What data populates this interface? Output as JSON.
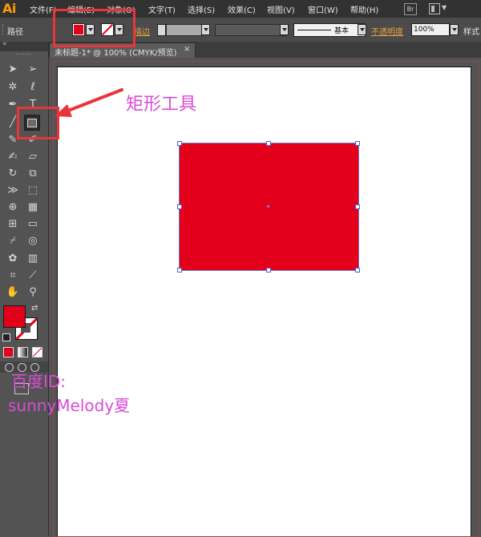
{
  "app": {
    "logo": "Ai"
  },
  "menu": {
    "items": [
      "文件(F)",
      "编辑(E)",
      "对象(O)",
      "文字(T)",
      "选择(S)",
      "效果(C)",
      "视图(V)",
      "窗口(W)",
      "帮助(H)"
    ]
  },
  "menu_right": {
    "bridge_label": "Br"
  },
  "control_bar": {
    "path_label": "路径",
    "fill_color": "#e2001a",
    "stroke": "none",
    "stroke_label": "描边",
    "stroke_profile": "基本",
    "opacity_label": "不透明度",
    "opacity_value": "100%",
    "style_label": "样式"
  },
  "document": {
    "tab_title": "未标题-1* @ 100% (CMYK/预览)",
    "close_symbol": "×"
  },
  "canvas": {
    "rectangle_fill": "#e2001a",
    "artboard_color": "#ffffff"
  },
  "tools": {
    "active_tool": "rectangle",
    "fill_color": "#e2001a",
    "icons": [
      "selection",
      "direct-selection",
      "magic-wand",
      "lasso",
      "pen",
      "type",
      "line",
      "rectangle",
      "paintbrush",
      "pencil",
      "blob-brush",
      "eraser",
      "rotate",
      "scale",
      "width",
      "free-transform",
      "shape-builder",
      "perspective-grid",
      "mesh",
      "gradient",
      "eyedropper",
      "blend",
      "symbol-sprayer",
      "column-graph",
      "artboard",
      "slice",
      "hand",
      "zoom"
    ]
  },
  "annotations": {
    "tool_label": "矩形工具",
    "id_label": "百度ID:",
    "username": "sunnyMelody夏",
    "color": "#d84cd6",
    "highlight_color": "#e8343a"
  }
}
